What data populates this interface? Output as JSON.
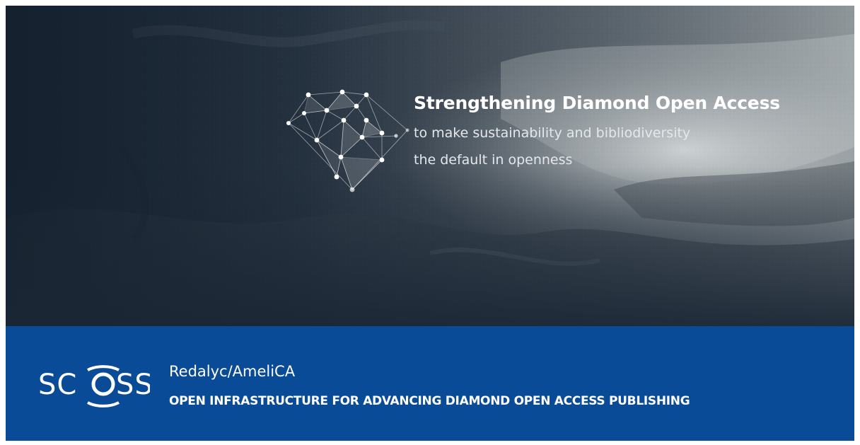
{
  "hero": {
    "title": "Strengthening Diamond Open Access",
    "subtitle_line1": "to make sustainability and bibliodiversity",
    "subtitle_line2": "the default in openness",
    "logo_icon": "diamond-network-icon"
  },
  "banner": {
    "brand": "SCOSS",
    "project_name": "Redalyc/AmeliCA",
    "tagline": "OPEN INFRASTRUCTURE FOR ADVANCING DIAMOND OPEN ACCESS PUBLISHING",
    "background_color": "#0a4b97"
  }
}
